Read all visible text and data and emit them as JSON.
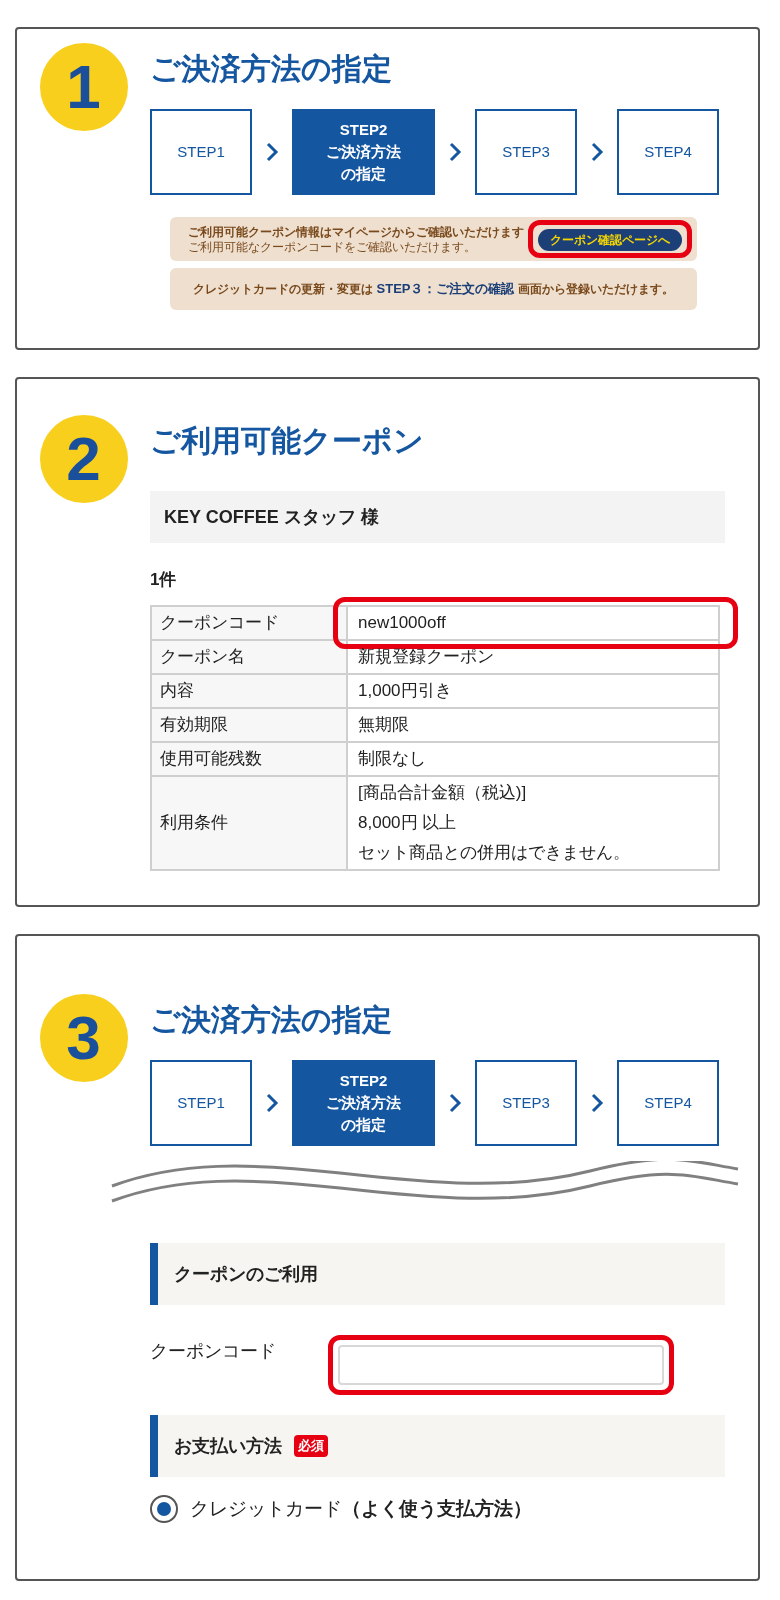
{
  "panels": [
    {
      "number": "1",
      "title": "ご決済方法の指定",
      "steps": [
        {
          "label": "STEP1",
          "selected": false
        },
        {
          "label": "STEP2\nご決済方法の指定",
          "selected": true
        },
        {
          "label": "STEP3",
          "selected": false
        },
        {
          "label": "STEP4",
          "selected": false
        }
      ],
      "notices": [
        {
          "kind": "coupon",
          "text": "ご利用可能クーポン情報はマイページからご確認いただけます",
          "subtext": "ご利用可能なクーポンコードをご確認いただけます。",
          "button": {
            "label": "クーポン確認ページへ",
            "highlighted": true
          }
        },
        {
          "kind": "plain",
          "parts": [
            {
              "text": "クレジットカードの更新・変更は ",
              "emphasis": false
            },
            {
              "text": "STEP３：ご注文の確認",
              "emphasis": true
            },
            {
              "text": " 画面から登録いただけます。",
              "emphasis": false
            }
          ]
        }
      ]
    },
    {
      "number": "2",
      "title": "ご利用可能クーポン",
      "recipient": "KEY COFFEE スタッフ 様",
      "count": "1件",
      "rows": [
        {
          "label": "クーポンコード",
          "lines": [
            "new1000off"
          ],
          "highlighted": true
        },
        {
          "label": "クーポン名",
          "lines": [
            "新規登録クーポン"
          ],
          "highlighted": false
        },
        {
          "label": "内容",
          "lines": [
            "1,000円引き"
          ],
          "highlighted": false
        },
        {
          "label": "有効期限",
          "lines": [
            "無期限"
          ],
          "highlighted": false
        },
        {
          "label": "使用可能残数",
          "lines": [
            "制限なし"
          ],
          "highlighted": false
        },
        {
          "label": "利用条件",
          "lines": [
            "[商品合計金額（税込)]",
            "8,000円 以上",
            "セット商品との併用はできません。"
          ],
          "highlighted": false
        }
      ]
    },
    {
      "number": "3",
      "title": "ご決済方法の指定",
      "steps": [
        {
          "label": "STEP1",
          "selected": false
        },
        {
          "label": "STEP2\nご決済方法の指定",
          "selected": true
        },
        {
          "label": "STEP3",
          "selected": false
        },
        {
          "label": "STEP4",
          "selected": false
        }
      ],
      "coupon_section": {
        "heading": "クーポンのご利用",
        "field_label": "クーポンコード",
        "field_highlighted": true
      },
      "payment_section": {
        "heading": "お支払い方法",
        "badge": "必須",
        "options": [
          {
            "label": "クレジットカード**（よく使う支払方法）**",
            "selected": true
          }
        ]
      }
    }
  ]
}
